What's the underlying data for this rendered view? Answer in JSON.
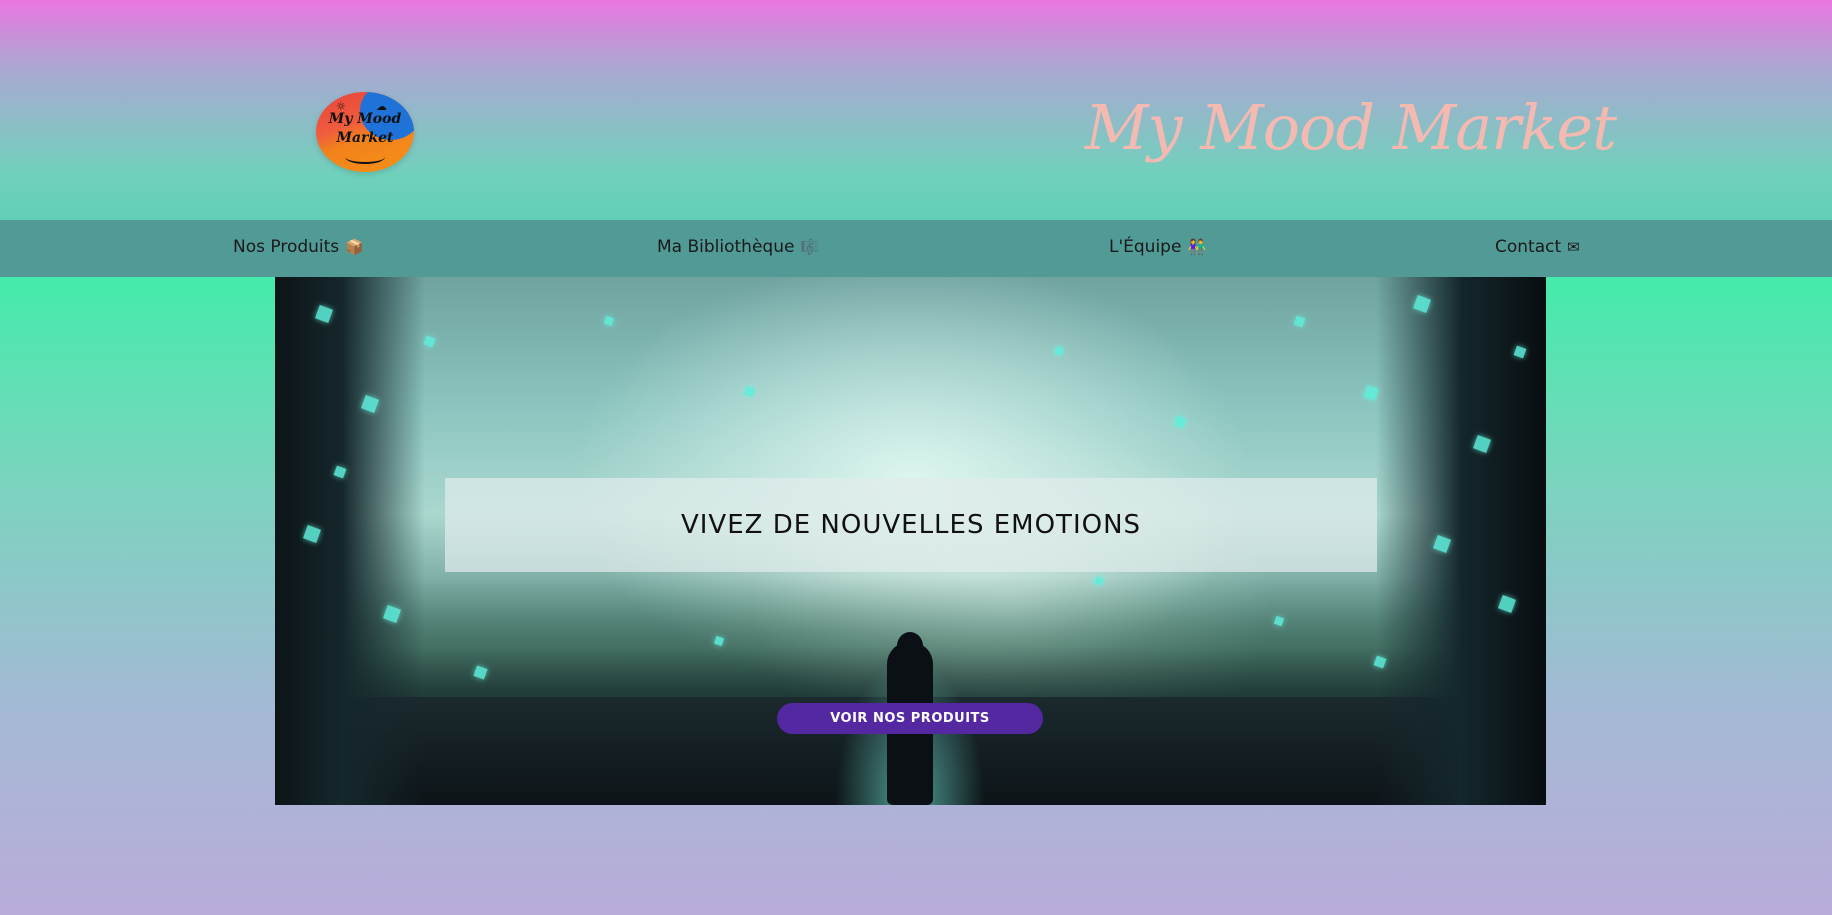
{
  "header": {
    "logo_text": "My Mood Market",
    "site_title": "My Mood Market"
  },
  "nav": {
    "items": [
      {
        "label": "Nos Produits",
        "icon": "📦",
        "icon_name": "box-icon"
      },
      {
        "label": "Ma Bibliothèque",
        "icon": "🎼",
        "icon_name": "music-library-icon"
      },
      {
        "label": "L'Équipe",
        "icon": "👫",
        "icon_name": "team-icon"
      },
      {
        "label": "Contact",
        "icon": "✉",
        "icon_name": "envelope-icon"
      }
    ]
  },
  "hero": {
    "heading": "VIVEZ DE NOUVELLES EMOTIONS",
    "cta_label": "VOIR NOS PRODUITS"
  },
  "colors": {
    "nav_bar": "#529a96",
    "title_text": "#f4b9b0",
    "cta_button": "#5428a0",
    "gradient_top": "#ea76e0",
    "gradient_mid": "#45ebab",
    "gradient_bottom": "#b9acd8"
  }
}
